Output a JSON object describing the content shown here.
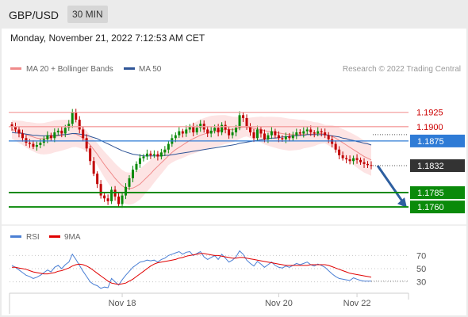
{
  "header": {
    "pair": "GBP/USD",
    "timeframe": "30 MIN"
  },
  "date_line": "Monday, November 21, 2022 7:12:53 AM CET",
  "copyright": "Research © 2022 Trading Central",
  "chart_data": [
    {
      "type": "candlestick",
      "legend": [
        {
          "name": "MA 20 + Bollinger Bands",
          "color": "#f08a8a"
        },
        {
          "name": "MA 50",
          "color": "#2f5597"
        }
      ],
      "y_range": [
        1.1745,
        1.1955
      ],
      "levels": [
        {
          "value": 1.1925,
          "label": "1.1925",
          "kind": "resistance",
          "color": "#f4a0a0"
        },
        {
          "value": 1.19,
          "label": "1.1900",
          "kind": "resistance",
          "color": "#f4a0a0"
        },
        {
          "value": 1.1875,
          "label": "1.1875",
          "kind": "pivot",
          "color": "#2e7bd6"
        },
        {
          "value": 1.1832,
          "label": "1.1832",
          "kind": "last-price",
          "color": "#333333"
        },
        {
          "value": 1.1785,
          "label": "1.1785",
          "kind": "support",
          "color": "#0a8a0a"
        },
        {
          "value": 1.176,
          "label": "1.1760",
          "kind": "support",
          "color": "#0a8a0a"
        }
      ],
      "close": [
        1.19,
        1.1895,
        1.1888,
        1.188,
        1.1872,
        1.187,
        1.1865,
        1.1868,
        1.1872,
        1.1878,
        1.1885,
        1.188,
        1.189,
        1.1893,
        1.1888,
        1.1898,
        1.1905,
        1.1925,
        1.1912,
        1.1895,
        1.188,
        1.1862,
        1.184,
        1.1818,
        1.18,
        1.178,
        1.1775,
        1.177,
        1.179,
        1.1778,
        1.1765,
        1.178,
        1.1795,
        1.181,
        1.1825,
        1.1835,
        1.1845,
        1.1848,
        1.1853,
        1.185,
        1.1852,
        1.1848,
        1.1855,
        1.186,
        1.187,
        1.188,
        1.1885,
        1.1892,
        1.1888,
        1.1895,
        1.19,
        1.189,
        1.1898,
        1.1905,
        1.1895,
        1.1888,
        1.1893,
        1.1898,
        1.189,
        1.1903,
        1.1895,
        1.1885,
        1.189,
        1.1898,
        1.192,
        1.1915,
        1.19,
        1.189,
        1.188,
        1.1895,
        1.1888,
        1.1878,
        1.1885,
        1.1892,
        1.1885,
        1.188,
        1.1878,
        1.1883,
        1.188,
        1.1885,
        1.189,
        1.1888,
        1.1892,
        1.1895,
        1.189,
        1.1888,
        1.1892,
        1.189,
        1.1885,
        1.1878,
        1.187,
        1.186,
        1.185,
        1.1845,
        1.1843,
        1.184,
        1.1845,
        1.1842,
        1.1838,
        1.1835,
        1.1833,
        1.1832
      ],
      "ma20": [
        1.1895,
        1.1893,
        1.1891,
        1.1889,
        1.1886,
        1.1884,
        1.1882,
        1.188,
        1.1879,
        1.1879,
        1.188,
        1.1881,
        1.1883,
        1.1884,
        1.1885,
        1.1886,
        1.1887,
        1.1888,
        1.1887,
        1.1884,
        1.188,
        1.1875,
        1.1868,
        1.186,
        1.1852,
        1.1843,
        1.1834,
        1.1826,
        1.1818,
        1.181,
        1.1803,
        1.1797,
        1.1793,
        1.1792,
        1.1793,
        1.1796,
        1.18,
        1.1806,
        1.1812,
        1.1818,
        1.1825,
        1.1831,
        1.1837,
        1.1843,
        1.1849,
        1.1855,
        1.186,
        1.1864,
        1.1868,
        1.1872,
        1.1876,
        1.1879,
        1.1882,
        1.1885,
        1.1887,
        1.1889,
        1.1891,
        1.1892,
        1.1893,
        1.1894,
        1.1895,
        1.1895,
        1.1895,
        1.1896,
        1.1898,
        1.1899,
        1.1899,
        1.1898,
        1.1897,
        1.1896,
        1.1895,
        1.1893,
        1.1892,
        1.1891,
        1.189,
        1.1889,
        1.1888,
        1.1887,
        1.1886,
        1.1886,
        1.1886,
        1.1886,
        1.1887,
        1.1887,
        1.1887,
        1.1887,
        1.1888,
        1.1888,
        1.1887,
        1.1885,
        1.1883,
        1.188,
        1.1876,
        1.1872,
        1.1868,
        1.1864,
        1.186,
        1.1856,
        1.1852,
        1.1848,
        1.1845,
        1.1842
      ],
      "ma50": [
        1.189,
        1.1889,
        1.1889,
        1.1888,
        1.1887,
        1.1886,
        1.1885,
        1.1885,
        1.1884,
        1.1884,
        1.1884,
        1.1884,
        1.1885,
        1.1885,
        1.1886,
        1.1886,
        1.1887,
        1.1888,
        1.1888,
        1.1887,
        1.1886,
        1.1885,
        1.1883,
        1.1881,
        1.1879,
        1.1876,
        1.1873,
        1.187,
        1.1867,
        1.1864,
        1.1861,
        1.1858,
        1.1856,
        1.1854,
        1.1852,
        1.1851,
        1.185,
        1.1849,
        1.1849,
        1.1849,
        1.1849,
        1.1849,
        1.1849,
        1.185,
        1.185,
        1.1851,
        1.1852,
        1.1853,
        1.1854,
        1.1855,
        1.1856,
        1.1857,
        1.1858,
        1.1859,
        1.186,
        1.1861,
        1.1862,
        1.1863,
        1.1864,
        1.1865,
        1.1866,
        1.1867,
        1.1868,
        1.1869,
        1.1871,
        1.1872,
        1.1873,
        1.1874,
        1.1875,
        1.1876,
        1.1877,
        1.1878,
        1.1879,
        1.188,
        1.188,
        1.1881,
        1.1882,
        1.1882,
        1.1883,
        1.1884,
        1.1884,
        1.1885,
        1.1885,
        1.1886,
        1.1886,
        1.1886,
        1.1886,
        1.1886,
        1.1886,
        1.1885,
        1.1884,
        1.1883,
        1.1882,
        1.188,
        1.1879,
        1.1877,
        1.1876,
        1.1874,
        1.1873,
        1.1871,
        1.187,
        1.1868
      ],
      "forecast_arrow": {
        "from": 1.1832,
        "to": 1.176
      }
    },
    {
      "type": "line",
      "legend": [
        {
          "name": "RSI",
          "color": "#4a7fd4"
        },
        {
          "name": "9MA",
          "color": "#e00000"
        }
      ],
      "y_range": [
        15,
        85
      ],
      "ticks": [
        "70",
        "50",
        "30"
      ],
      "tick_values": [
        70,
        50,
        30
      ],
      "rsi": [
        55,
        52,
        48,
        44,
        40,
        38,
        35,
        37,
        40,
        44,
        48,
        45,
        52,
        55,
        50,
        56,
        60,
        72,
        64,
        55,
        46,
        38,
        30,
        26,
        24,
        20,
        22,
        21,
        35,
        30,
        25,
        33,
        40,
        46,
        52,
        56,
        60,
        61,
        63,
        62,
        63,
        60,
        64,
        66,
        70,
        72,
        74,
        76,
        72,
        75,
        76,
        70,
        73,
        76,
        68,
        64,
        67,
        70,
        64,
        72,
        66,
        60,
        63,
        68,
        77,
        72,
        63,
        58,
        54,
        61,
        57,
        52,
        56,
        60,
        55,
        52,
        51,
        54,
        52,
        55,
        58,
        56,
        58,
        60,
        56,
        54,
        57,
        55,
        52,
        47,
        42,
        38,
        35,
        34,
        33,
        32,
        36,
        34,
        32,
        31,
        31,
        31
      ],
      "ma9": [
        52,
        52,
        51,
        50,
        49,
        47,
        45,
        44,
        43,
        42,
        42,
        43,
        44,
        46,
        47,
        49,
        51,
        54,
        56,
        57,
        56,
        54,
        51,
        47,
        43,
        39,
        35,
        31,
        28,
        27,
        26,
        27,
        28,
        31,
        34,
        38,
        42,
        46,
        50,
        54,
        57,
        59,
        60,
        61,
        62,
        63,
        64,
        66,
        67,
        69,
        70,
        71,
        72,
        73,
        73,
        72,
        71,
        70,
        70,
        69,
        68,
        67,
        66,
        66,
        67,
        67,
        66,
        65,
        64,
        63,
        62,
        61,
        60,
        59,
        58,
        57,
        56,
        55,
        55,
        55,
        55,
        55,
        55,
        55,
        56,
        56,
        56,
        56,
        56,
        55,
        53,
        51,
        49,
        47,
        45,
        43,
        42,
        41,
        40,
        39,
        38,
        37
      ]
    }
  ],
  "x_axis": {
    "labels": [
      "Nov 18",
      "Nov 20",
      "Nov 22"
    ],
    "label_index": [
      31,
      75,
      97
    ]
  }
}
